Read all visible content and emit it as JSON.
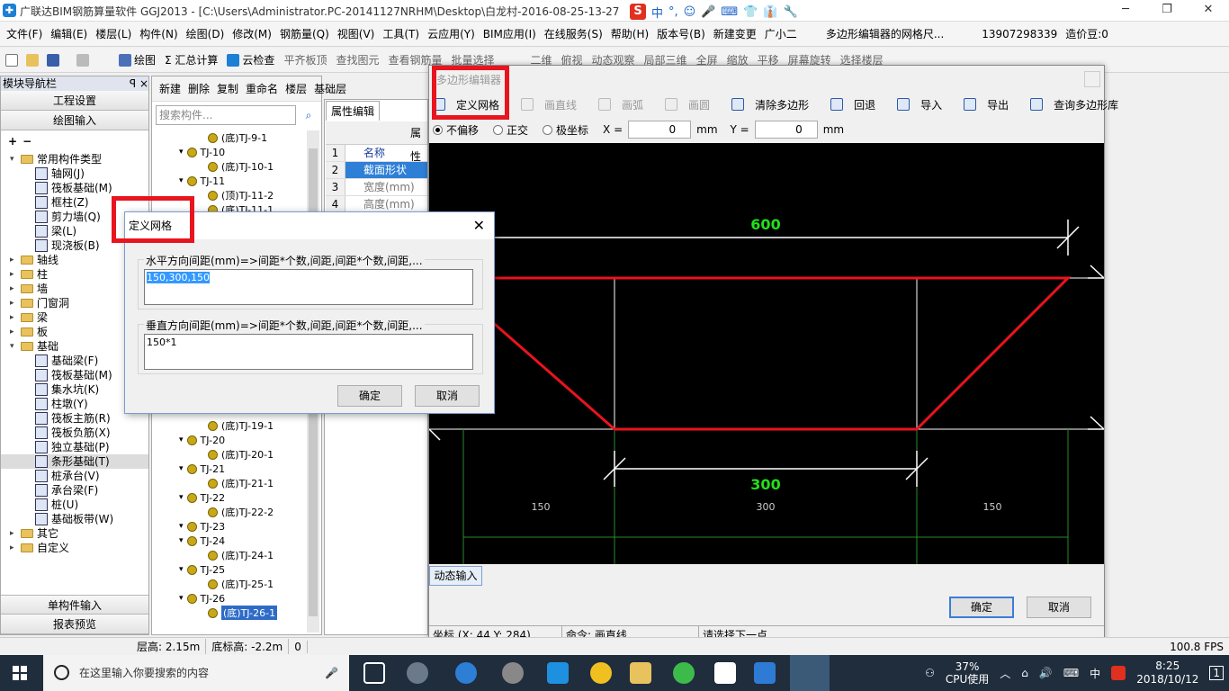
{
  "window": {
    "title": "广联达BIM钢筋算量软件 GGJ2013 - [C:\\Users\\Administrator.PC-20141127NRHM\\Desktop\\白龙村-2016-08-25-13-27",
    "controls": [
      "─",
      "❐",
      "✕"
    ],
    "ime": [
      "S",
      "中",
      "°,",
      "☺",
      "🎤",
      "⌨",
      "👕",
      "👔",
      "🔧"
    ]
  },
  "menu": [
    "文件(F)",
    "编辑(E)",
    "楼层(L)",
    "构件(N)",
    "绘图(D)",
    "修改(M)",
    "钢筋量(Q)",
    "视图(V)",
    "工具(T)",
    "云应用(Y)",
    "BIM应用(I)",
    "在线服务(S)",
    "帮助(H)",
    "版本号(B)",
    "新建变更",
    "广小二",
    "多边形编辑器的网格尺...",
    "13907298339",
    "造价豆:0"
  ],
  "toolbar": [
    "绘图",
    "Σ 汇总计算",
    "云检查",
    "平齐板顶",
    "查找图元",
    "查看钢筋量",
    "批量选择",
    "二维",
    "俯视",
    "动态观察",
    "局部三维",
    "全屏",
    "缩放",
    "平移",
    "屏幕旋转",
    "选择楼层"
  ],
  "leftnav": {
    "header": "模块导航栏",
    "pin": "ꟼ ×",
    "btn_project": "工程设置",
    "btn_draw": "绘图输入",
    "btn_single": "单构件输入",
    "btn_report": "报表预览",
    "tree": [
      {
        "label": "常用构件类型",
        "level": 0,
        "type": "folder",
        "exp": "▾"
      },
      {
        "label": "轴网(J)",
        "level": 1,
        "type": "item"
      },
      {
        "label": "筏板基础(M)",
        "level": 1,
        "type": "item"
      },
      {
        "label": "框柱(Z)",
        "level": 1,
        "type": "item"
      },
      {
        "label": "剪力墙(Q)",
        "level": 1,
        "type": "item"
      },
      {
        "label": "梁(L)",
        "level": 1,
        "type": "item"
      },
      {
        "label": "现浇板(B)",
        "level": 1,
        "type": "item"
      },
      {
        "label": "轴线",
        "level": 0,
        "type": "folder",
        "exp": "▸"
      },
      {
        "label": "柱",
        "level": 0,
        "type": "folder",
        "exp": "▸"
      },
      {
        "label": "墙",
        "level": 0,
        "type": "folder",
        "exp": "▸"
      },
      {
        "label": "门窗洞",
        "level": 0,
        "type": "folder",
        "exp": "▸"
      },
      {
        "label": "梁",
        "level": 0,
        "type": "folder",
        "exp": "▸"
      },
      {
        "label": "板",
        "level": 0,
        "type": "folder",
        "exp": "▸"
      },
      {
        "label": "基础",
        "level": 0,
        "type": "folder",
        "exp": "▾"
      },
      {
        "label": "基础梁(F)",
        "level": 1,
        "type": "item"
      },
      {
        "label": "筏板基础(M)",
        "level": 1,
        "type": "item"
      },
      {
        "label": "集水坑(K)",
        "level": 1,
        "type": "item"
      },
      {
        "label": "柱墩(Y)",
        "level": 1,
        "type": "item"
      },
      {
        "label": "筏板主筋(R)",
        "level": 1,
        "type": "item"
      },
      {
        "label": "筏板负筋(X)",
        "level": 1,
        "type": "item"
      },
      {
        "label": "独立基础(P)",
        "level": 1,
        "type": "item"
      },
      {
        "label": "条形基础(T)",
        "level": 1,
        "type": "item",
        "selected": true
      },
      {
        "label": "桩承台(V)",
        "level": 1,
        "type": "item"
      },
      {
        "label": "承台梁(F)",
        "level": 1,
        "type": "item"
      },
      {
        "label": "桩(U)",
        "level": 1,
        "type": "item"
      },
      {
        "label": "基础板带(W)",
        "level": 1,
        "type": "item"
      },
      {
        "label": "其它",
        "level": 0,
        "type": "folder",
        "exp": "▸"
      },
      {
        "label": "自定义",
        "level": 0,
        "type": "folder",
        "exp": "▸"
      }
    ]
  },
  "midpanel": {
    "tools": [
      "新建",
      "删除",
      "复制",
      "重命名",
      "楼层",
      "基础层"
    ],
    "search_placeholder": "搜索构件...",
    "tree": [
      {
        "label": "(底)TJ-9-1",
        "child": true
      },
      {
        "label": "TJ-10",
        "child": false
      },
      {
        "label": "(底)TJ-10-1",
        "child": true
      },
      {
        "label": "TJ-11",
        "child": false
      },
      {
        "label": "(顶)TJ-11-2",
        "child": true
      },
      {
        "label": "(底)TJ-11-1",
        "child": true
      },
      {
        "label": "(底)TJ-19-1",
        "child": true,
        "gap": true
      },
      {
        "label": "TJ-20",
        "child": false
      },
      {
        "label": "(底)TJ-20-1",
        "child": true
      },
      {
        "label": "TJ-21",
        "child": false
      },
      {
        "label": "(底)TJ-21-1",
        "child": true
      },
      {
        "label": "TJ-22",
        "child": false
      },
      {
        "label": "(底)TJ-22-2",
        "child": true
      },
      {
        "label": "TJ-23",
        "child": false
      },
      {
        "label": "TJ-24",
        "child": false
      },
      {
        "label": "(底)TJ-24-1",
        "child": true
      },
      {
        "label": "TJ-25",
        "child": false
      },
      {
        "label": "(底)TJ-25-1",
        "child": true
      },
      {
        "label": "TJ-26",
        "child": false
      },
      {
        "label": "(底)TJ-26-1",
        "child": true,
        "selected": true
      }
    ]
  },
  "props": {
    "tab": "属性编辑",
    "col": "属性",
    "rows": [
      {
        "n": "1",
        "v": "名称"
      },
      {
        "n": "2",
        "v": "截面形状",
        "selected": true
      },
      {
        "n": "3",
        "v": "宽度(mm)"
      },
      {
        "n": "4",
        "v": "高度(mm)"
      }
    ]
  },
  "poly_editor": {
    "title": "多边形编辑器",
    "tools": [
      {
        "label": "定义网格",
        "enabled": true
      },
      {
        "label": "画直线",
        "enabled": false
      },
      {
        "label": "画弧",
        "enabled": false
      },
      {
        "label": "画圆",
        "enabled": false
      },
      {
        "label": "清除多边形",
        "enabled": true
      },
      {
        "label": "回退",
        "enabled": true
      },
      {
        "label": "导入",
        "enabled": true
      },
      {
        "label": "导出",
        "enabled": true
      },
      {
        "label": "查询多边形库",
        "enabled": true
      }
    ],
    "offset_options": [
      "不偏移",
      "正交",
      "极坐标"
    ],
    "x_label": "X =",
    "x_value": "0",
    "y_label": "Y =",
    "y_value": "0",
    "unit": "mm",
    "dim_top": "600",
    "dim_bottom": "300",
    "grid_labels": [
      "150",
      "300",
      "150"
    ],
    "dynamic_input": "动态输入",
    "ok": "确定",
    "cancel": "取消",
    "status_coord": "坐标 (X: 44 Y: 284)",
    "status_cmd": "命令: 画直线",
    "status_hint": "请选择下一点"
  },
  "grid_dialog": {
    "title": "定义网格",
    "h_label": "水平方向间距(mm)=>间距*个数,间距,间距*个数,间距,...",
    "h_value": "150,300,150",
    "v_label": "垂直方向间距(mm)=>间距*个数,间距,间距*个数,间距,...",
    "v_value": "150*1",
    "ok": "确定",
    "cancel": "取消"
  },
  "statusbar": [
    "层高: 2.15m",
    "底标高: -2.2m",
    "0",
    "100.8 FPS"
  ],
  "taskbar": {
    "search": "在这里输入你要搜索的内容",
    "cpu": "37%",
    "cpu_label": "CPU使用",
    "time": "8:25",
    "date": "2018/10/12",
    "lang": "中",
    "notify": "1"
  },
  "colors": {
    "highlight": "#e8141e",
    "dim_text": "#22e01a",
    "selection": "#3399ff",
    "polygon": "#e8141e"
  }
}
